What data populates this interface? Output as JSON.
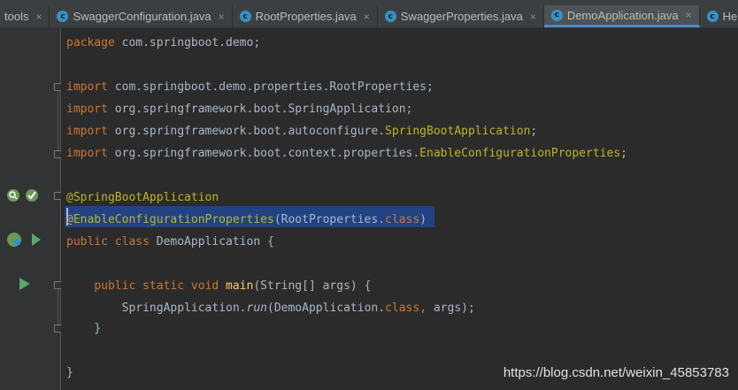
{
  "tabs": [
    {
      "label": "tools",
      "icon": "none",
      "active": false
    },
    {
      "label": "SwaggerConfiguration.java",
      "icon": "class-icon",
      "active": false
    },
    {
      "label": "RootProperties.java",
      "icon": "class-icon",
      "active": false
    },
    {
      "label": "SwaggerProperties.java",
      "icon": "class-icon",
      "active": false
    },
    {
      "label": "DemoApplication.java",
      "icon": "spring-boot-class-icon",
      "active": true
    },
    {
      "label": "He",
      "icon": "class-icon",
      "active": false
    }
  ],
  "close_glyph": "×",
  "code": {
    "l1": {
      "kw": "package",
      "rest": " com.springboot.demo;"
    },
    "l3": {
      "kw": "import",
      "rest": " com.springboot.demo.properties.RootProperties;"
    },
    "l4": {
      "kw": "import",
      "rest": " org.springframework.boot.SpringApplication;"
    },
    "l5": {
      "kw": "import",
      "rest": " org.springframework.boot.autoconfigure.",
      "cls": "SpringBootApplication",
      "end": ";"
    },
    "l6": {
      "kw": "import",
      "rest": " org.springframework.boot.context.properties.",
      "cls": "EnableConfigurationProperties",
      "end": ";"
    },
    "l8": {
      "ann": "@SpringBootApplication"
    },
    "l9": {
      "ann": "@EnableConfigurationProperties",
      "open": "(RootProperties.",
      "kw": "class",
      "close": ")"
    },
    "l10": {
      "kw": "public class",
      "rest": " DemoApplication {"
    },
    "l12": {
      "kw": "public static void",
      "fn": " main",
      "rest": "(String[] args) {"
    },
    "l13": {
      "pre": "SpringApplication.",
      "it": "run",
      "mid": "(DemoApplication.",
      "kw": "class,",
      "rest": " args);"
    },
    "l14": {
      "rest": "}"
    },
    "l16": {
      "rest": "}"
    }
  },
  "watermark": "https://blog.csdn.net/weixin_45853783"
}
